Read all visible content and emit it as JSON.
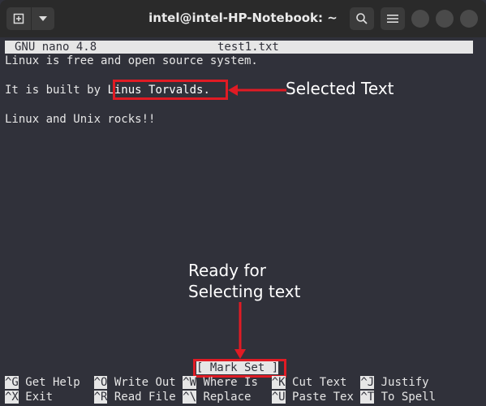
{
  "window": {
    "title": "intel@intel-HP-Notebook: ~",
    "icons": {
      "new_tab": "new-tab-icon",
      "menu_dropdown": "chevron-down-icon",
      "search": "search-icon",
      "hamburger": "hamburger-menu-icon",
      "minimize": "minimize-icon",
      "maximize": "maximize-icon",
      "close": "close-icon"
    }
  },
  "nano": {
    "header_app": "GNU nano 4.8",
    "header_file": "test1.txt",
    "lines": [
      "Linux is free and open source system.",
      "",
      "It is built by ",
      "",
      "Linux and Unix rocks!!"
    ],
    "selected_text": "Linus Torvalds.",
    "status": "[ Mark Set ]",
    "shortcuts_row1": [
      {
        "key": "^G",
        "label": "Get Help"
      },
      {
        "key": "^O",
        "label": "Write Out"
      },
      {
        "key": "^W",
        "label": "Where Is"
      },
      {
        "key": "^K",
        "label": "Cut Text"
      },
      {
        "key": "^J",
        "label": "Justify"
      }
    ],
    "shortcuts_row2": [
      {
        "key": "^X",
        "label": "Exit"
      },
      {
        "key": "^R",
        "label": "Read File"
      },
      {
        "key": "^\\",
        "label": "Replace"
      },
      {
        "key": "^U",
        "label": "Paste Tex"
      },
      {
        "key": "^T",
        "label": "To Spell"
      }
    ]
  },
  "annotations": {
    "selected_text_label": "Selected Text",
    "ready_label_line1": "Ready for",
    "ready_label_line2": "Selecting text",
    "accent_color": "#e01b24"
  }
}
